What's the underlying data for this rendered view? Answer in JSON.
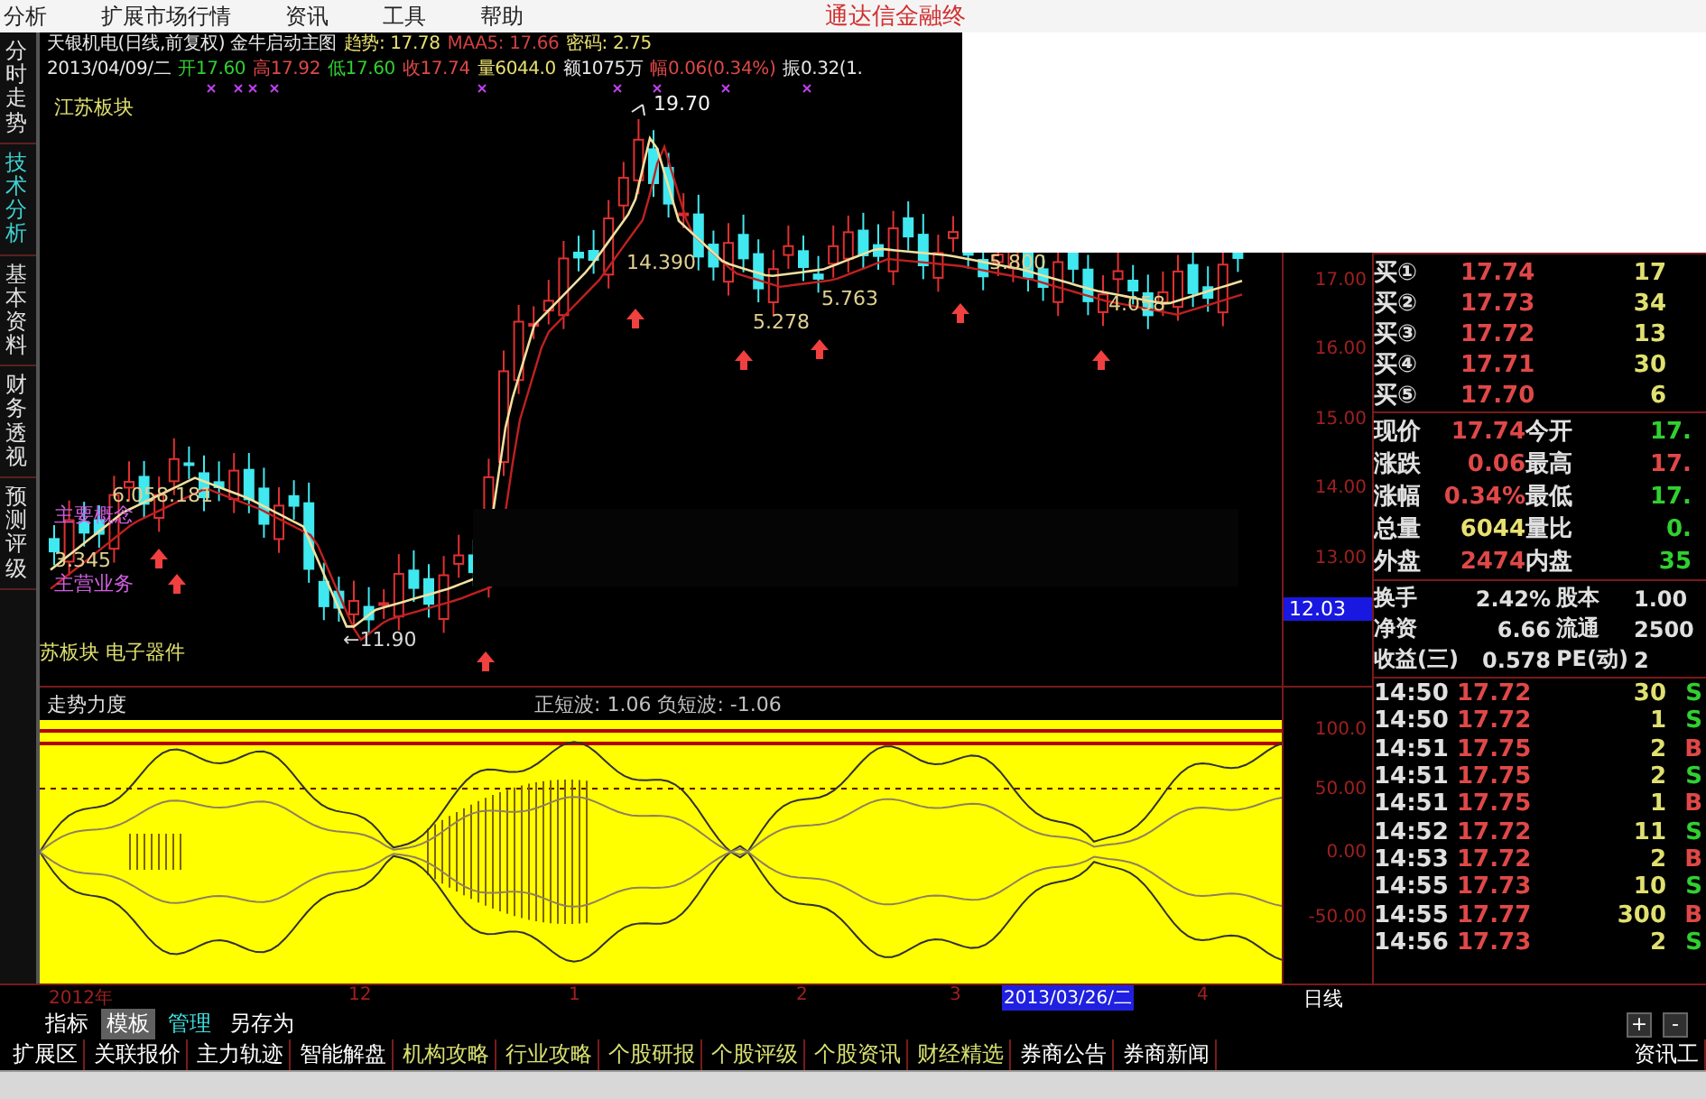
{
  "menu": [
    "分析",
    "扩展市场行情",
    "资讯",
    "工具",
    "帮助"
  ],
  "brand_text": "通达信金融终",
  "side_tabs": [
    {
      "label": "分时走势",
      "selected": false
    },
    {
      "label": "技术分析",
      "selected": true
    },
    {
      "label": "基本资料",
      "selected": false
    },
    {
      "label": "财务透视",
      "selected": false
    },
    {
      "label": "预测评级",
      "selected": false
    }
  ],
  "chart": {
    "header_line_1": [
      {
        "text": "天银机电(日线,前复权) 金牛启动主图",
        "color": "#e8e8e8"
      },
      {
        "text": "趋势: 17.78",
        "color": "#e8e070"
      },
      {
        "text": "MAA5: 17.66",
        "color": "#d04040"
      },
      {
        "text": "密码: 2.75",
        "color": "#e8e070"
      }
    ],
    "header_line_2": [
      {
        "text": "2013/04/09/二",
        "color": "#e8e8e8"
      },
      {
        "text": "开17.60",
        "color": "#30d030"
      },
      {
        "text": "高17.92",
        "color": "#e04848"
      },
      {
        "text": "低17.60",
        "color": "#30d030"
      },
      {
        "text": "收17.74",
        "color": "#e04848"
      },
      {
        "text": "量6044.0",
        "color": "#e8e070"
      },
      {
        "text": "额1075万",
        "color": "#e8e8e8"
      },
      {
        "text": "幅0.06(0.34%)",
        "color": "#e04848"
      },
      {
        "text": "振0.32(1.",
        "color": "#e8e8e8"
      }
    ],
    "labels": [
      {
        "text": "江苏板块",
        "kind": "tag"
      },
      {
        "text": "19.70",
        "kind": "peak"
      },
      {
        "text": "14.390",
        "kind": "value"
      },
      {
        "text": "5.278",
        "kind": "value"
      },
      {
        "text": "5.763",
        "kind": "value"
      },
      {
        "text": "5.800",
        "kind": "value"
      },
      {
        "text": "4.058",
        "kind": "value"
      },
      {
        "text": "6.058.181",
        "kind": "value"
      },
      {
        "text": "主要概念",
        "kind": "concept"
      },
      {
        "text": "3.345",
        "kind": "value"
      },
      {
        "text": "主营业务",
        "kind": "concept"
      },
      {
        "text": "←11.90",
        "kind": "trough"
      },
      {
        "text": "苏板块  电子器件",
        "kind": "tag"
      }
    ]
  },
  "price_axis": [
    "17.00",
    "16.00",
    "15.00",
    "14.00",
    "13.00"
  ],
  "cursor_price": "12.03",
  "order_book": [
    {
      "label": "买①",
      "price": "17.74",
      "volume": "17"
    },
    {
      "label": "买②",
      "price": "17.73",
      "volume": "34"
    },
    {
      "label": "买③",
      "price": "17.72",
      "volume": "13"
    },
    {
      "label": "买④",
      "price": "17.71",
      "volume": "30"
    },
    {
      "label": "买⑤",
      "price": "17.70",
      "volume": "6"
    }
  ],
  "quote": [
    {
      "left": {
        "label": "现价",
        "value": "17.74",
        "color": "#e04848"
      },
      "right": {
        "label": "今开",
        "value": "17.",
        "color": "#30d030"
      }
    },
    {
      "left": {
        "label": "涨跌",
        "value": "0.06",
        "color": "#e04848"
      },
      "right": {
        "label": "最高",
        "value": "17.",
        "color": "#e04848"
      }
    },
    {
      "left": {
        "label": "涨幅",
        "value": "0.34%",
        "color": "#e04848"
      },
      "right": {
        "label": "最低",
        "value": "17.",
        "color": "#30d030"
      }
    },
    {
      "left": {
        "label": "总量",
        "value": "6044",
        "color": "#e8e070"
      },
      "right": {
        "label": "量比",
        "value": "0.",
        "color": "#30d030"
      }
    },
    {
      "left": {
        "label": "外盘",
        "value": "2474",
        "color": "#e04848"
      },
      "right": {
        "label": "内盘",
        "value": "35",
        "color": "#30d030"
      }
    }
  ],
  "stats": [
    {
      "label": "换手",
      "value": "2.42%",
      "label2": "股本",
      "value2": "1.00"
    },
    {
      "label": "净资",
      "value": "6.66",
      "label2": "流通",
      "value2": "2500"
    },
    {
      "label": "收益(三)",
      "value": "0.578",
      "label2": "PE(动)",
      "value2": "2"
    }
  ],
  "indicator": {
    "name": "走势力度",
    "readout": "正短波: 1.06 负短波: -1.06",
    "axis": [
      "100.0",
      "50.00",
      "0.00",
      "-50.00"
    ]
  },
  "ticks": [
    {
      "time": "14:50",
      "price": "17.72",
      "volume": "30",
      "side": "S",
      "kind": "sell"
    },
    {
      "time": "14:50",
      "price": "17.72",
      "volume": "1",
      "side": "S",
      "kind": "sell"
    },
    {
      "time": "14:51",
      "price": "17.75",
      "volume": "2",
      "side": "B",
      "kind": "buy"
    },
    {
      "time": "14:51",
      "price": "17.75",
      "volume": "2",
      "side": "S",
      "kind": "sell"
    },
    {
      "time": "14:51",
      "price": "17.75",
      "volume": "1",
      "side": "B",
      "kind": "buy"
    },
    {
      "time": "14:52",
      "price": "17.72",
      "volume": "11",
      "side": "S",
      "kind": "sell"
    },
    {
      "time": "14:53",
      "price": "17.72",
      "volume": "2",
      "side": "B",
      "kind": "buy"
    },
    {
      "time": "14:55",
      "price": "17.73",
      "volume": "10",
      "side": "S",
      "kind": "sell"
    },
    {
      "time": "14:55",
      "price": "17.77",
      "volume": "300",
      "side": "B",
      "kind": "buy"
    },
    {
      "time": "14:56",
      "price": "17.73",
      "volume": "2",
      "side": "S",
      "kind": "sell"
    }
  ],
  "date_axis": [
    {
      "label": "2012年",
      "selected": false
    },
    {
      "label": "12",
      "selected": false
    },
    {
      "label": "1",
      "selected": false
    },
    {
      "label": "2",
      "selected": false
    },
    {
      "label": "3",
      "selected": false
    },
    {
      "label": "2013/03/26/二",
      "selected": true
    },
    {
      "label": "4",
      "selected": false
    }
  ],
  "period": "日线",
  "bottom_tabs": [
    {
      "label": "指标",
      "selected": false,
      "kind": "tab"
    },
    {
      "label": "模板",
      "selected": true,
      "kind": "tab"
    },
    {
      "label": "管理",
      "selected": false,
      "kind": "link"
    },
    {
      "label": "另存为",
      "selected": false,
      "kind": "tab"
    }
  ],
  "zoom_buttons": [
    "+",
    "-"
  ],
  "info_tabs": [
    {
      "label": "扩展区",
      "kind": "market"
    },
    {
      "label": "关联报价",
      "kind": "market"
    },
    {
      "label": "主力轨迹",
      "kind": "market"
    },
    {
      "label": "智能解盘",
      "kind": "market"
    },
    {
      "label": "机构攻略",
      "kind": "research"
    },
    {
      "label": "行业攻略",
      "kind": "research"
    },
    {
      "label": "个股研报",
      "kind": "research"
    },
    {
      "label": "个股评级",
      "kind": "research"
    },
    {
      "label": "个股资讯",
      "kind": "research"
    },
    {
      "label": "财经精选",
      "kind": "research"
    },
    {
      "label": "券商公告",
      "kind": "market"
    },
    {
      "label": "券商新闻",
      "kind": "market"
    }
  ],
  "info_tool": "资讯工"
}
